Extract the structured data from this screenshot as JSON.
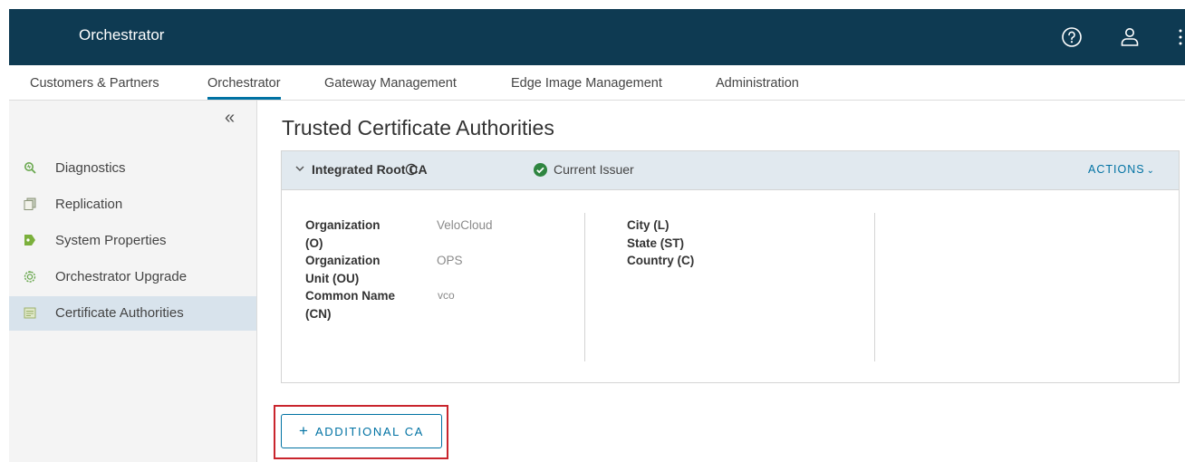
{
  "header": {
    "app_title": "Orchestrator",
    "icons": [
      "help-icon",
      "user-icon",
      "more-vertical-icon"
    ]
  },
  "nav": {
    "tabs": [
      {
        "label": "Customers & Partners"
      },
      {
        "label": "Orchestrator",
        "active": true
      },
      {
        "label": "Gateway Management"
      },
      {
        "label": "Edge Image Management"
      },
      {
        "label": "Administration"
      }
    ]
  },
  "sidebar": {
    "collapse_icon": "double-chevron-left-icon",
    "items": [
      {
        "label": "Diagnostics",
        "icon": "diagnostics-icon"
      },
      {
        "label": "Replication",
        "icon": "replication-icon"
      },
      {
        "label": "System Properties",
        "icon": "system-properties-icon"
      },
      {
        "label": "Orchestrator Upgrade",
        "icon": "upgrade-icon"
      },
      {
        "label": "Certificate Authorities",
        "icon": "certificate-icon",
        "selected": true
      }
    ]
  },
  "page": {
    "title": "Trusted Certificate Authorities"
  },
  "ca": {
    "name": "Integrated Root CA",
    "status": "Current Issuer",
    "actions_label": "ACTIONS",
    "fields_left": [
      {
        "label_lines": [
          "Organization",
          "(O)"
        ],
        "value": "VeloCloud"
      },
      {
        "label_lines": [
          "Organization",
          "Unit (OU)"
        ],
        "value": "OPS"
      },
      {
        "label_lines": [
          "Common Name",
          "(CN)"
        ],
        "value": "vco"
      }
    ],
    "fields_right": [
      {
        "label": "City (L)"
      },
      {
        "label": "State (ST)"
      },
      {
        "label": "Country (C)"
      }
    ]
  },
  "add_ca_button": {
    "label": "ADDITIONAL CA",
    "icon": "plus-icon"
  },
  "colors": {
    "header_bg": "#0e3a52",
    "accent": "#0072a3",
    "success": "#2e8540",
    "highlight": "#c9252d",
    "selected_bg": "#d8e3ec"
  }
}
